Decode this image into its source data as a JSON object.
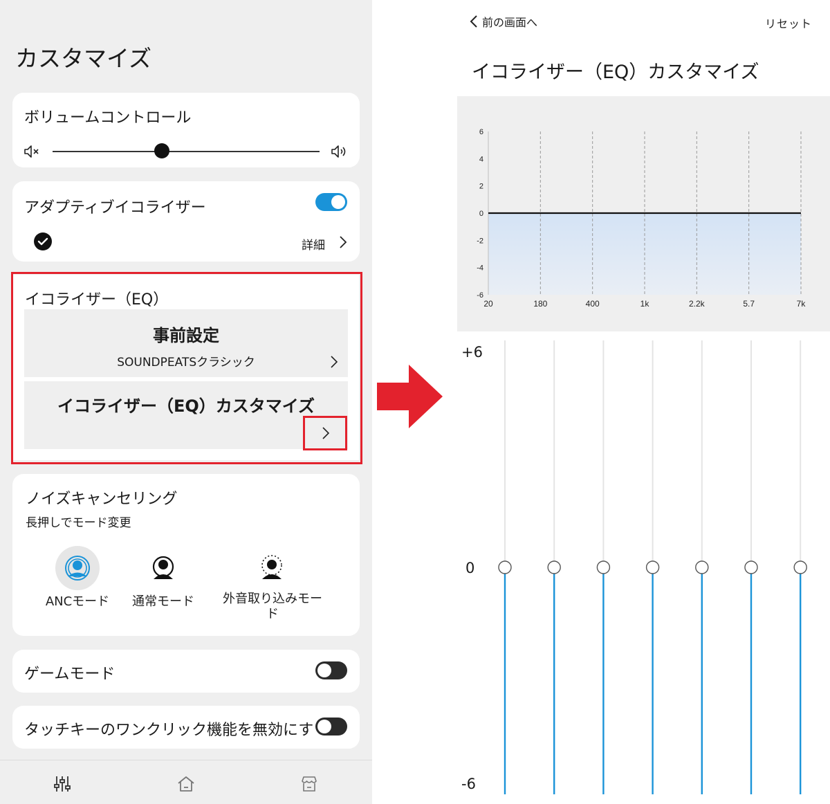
{
  "left": {
    "page_title": "カスタマイズ",
    "volume": {
      "title": "ボリュームコントロール",
      "mute_icon": "speaker-mute-icon",
      "loud_icon": "speaker-loud-icon",
      "level": 0.41
    },
    "adaptive_eq": {
      "title": "アダプティブイコライザー",
      "enabled": true,
      "detail_label": "詳細"
    },
    "eq": {
      "title": "イコライザー（EQ）",
      "preset": {
        "title": "事前設定",
        "value": "SOUNDPEATSクラシック"
      },
      "customize": {
        "title": "イコライザー（EQ）カスタマイズ"
      }
    },
    "noise_cancel": {
      "title": "ノイズキャンセリング",
      "subtitle": "長押しでモード変更",
      "modes": [
        {
          "label": "ANCモード",
          "icon": "anc-mode-icon",
          "selected": true
        },
        {
          "label": "通常モード",
          "icon": "normal-mode-icon",
          "selected": false
        },
        {
          "label": "外音取り込みモード",
          "icon": "ambient-mode-icon",
          "selected": false
        }
      ]
    },
    "game_mode": {
      "title": "ゲームモード",
      "enabled": false
    },
    "touch_key": {
      "title": "タッチキーのワンクリック機能を無効にす",
      "enabled": false
    },
    "bottom_nav": [
      {
        "icon": "equalizer-icon"
      },
      {
        "icon": "home-icon"
      },
      {
        "icon": "store-icon"
      }
    ]
  },
  "right": {
    "back_label": "前の画面へ",
    "reset_label": "リセット",
    "title": "イコライザー（EQ）カスタマイズ",
    "slider_scale": {
      "top": "+6",
      "middle": "0",
      "bottom": "-6"
    },
    "band_gains": [
      0,
      0,
      0,
      0,
      0,
      0,
      0
    ]
  },
  "colors": {
    "accent": "#1a93d8",
    "highlight": "#e3222d",
    "card": "#ffffff",
    "background": "#efefef"
  },
  "chart_data": {
    "type": "line",
    "x": [
      "20",
      "180",
      "400",
      "1k",
      "2.2k",
      "5.7",
      "7k"
    ],
    "series": [
      {
        "values": [
          0,
          0,
          0,
          0,
          0,
          0,
          0
        ]
      }
    ],
    "yticks": [
      "6",
      "4",
      "2",
      "0",
      "-2",
      "-4",
      "-6"
    ],
    "ylim": [
      -6,
      6
    ],
    "grid": "vertical-dashed"
  }
}
